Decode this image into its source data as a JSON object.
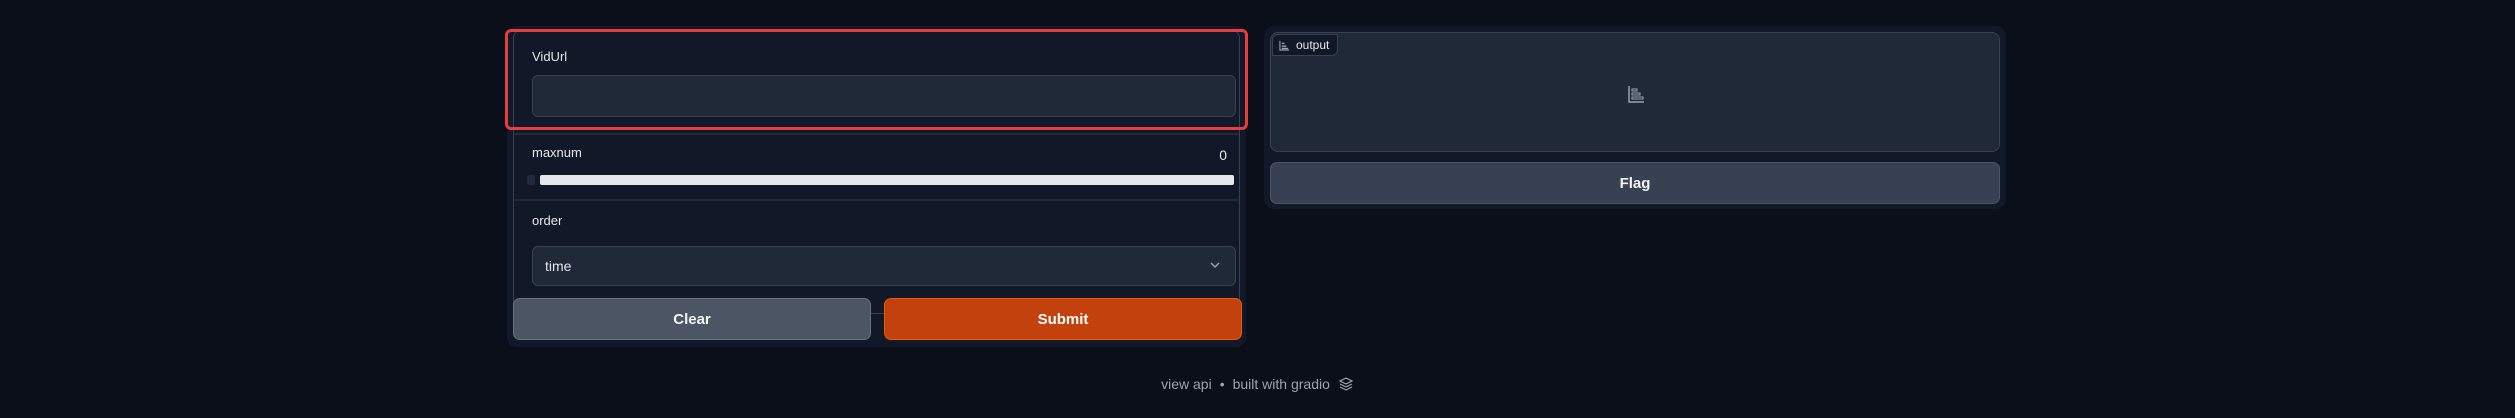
{
  "inputs": {
    "vidurl": {
      "label": "VidUrl",
      "value": "",
      "placeholder": ""
    },
    "maxnum": {
      "label": "maxnum",
      "value": "0",
      "level": 0
    },
    "order": {
      "label": "order",
      "selected": "time"
    }
  },
  "buttons": {
    "clear": "Clear",
    "submit": "Submit",
    "flag": "Flag"
  },
  "output": {
    "label": "output",
    "icon": "bar-chart-icon"
  },
  "footer": {
    "view_api": "view api",
    "separator": "•",
    "built_with": "built with gradio",
    "logo_icon": "gradio-logo-icon"
  },
  "colors": {
    "background": "#0b0f19",
    "panel": "#111827",
    "highlight": "#e53e3e",
    "submit": "#c2410c"
  }
}
